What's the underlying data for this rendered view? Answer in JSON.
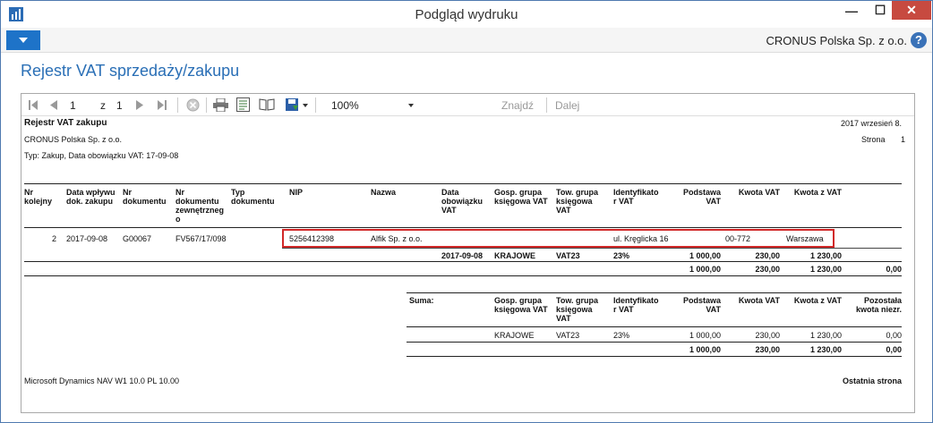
{
  "window": {
    "title": "Podgląd wydruku",
    "min": "—",
    "max": "☐",
    "close": "✕"
  },
  "ribbon": {
    "company": "CRONUS Polska Sp. z o.o.",
    "help": "?"
  },
  "page_title": "Rejestr VAT sprzedaży/zakupu",
  "toolbar": {
    "page_current": "1",
    "page_of": "z",
    "page_total": "1",
    "zoom": "100%",
    "find": "Znajdź",
    "next": "Dalej"
  },
  "report": {
    "title": "Rejestr VAT zakupu",
    "date": "2017 wrzesień 8.",
    "company": "CRONUS Polska Sp. z o.o.",
    "page_label": "Strona",
    "page_num": "1",
    "filter": "Typ: Zakup, Data obowiązku VAT: 17-09-08",
    "headers": {
      "nr": "Nr\nkolejny",
      "data_wplywu": "Data wpływu\ndok. zakupu",
      "nr_dok": "Nr\ndokumentu",
      "nr_zewn": "Nr\ndokumentu\nzewnętrzneg\no",
      "typ": "Typ\ndokumentu",
      "nip": "NIP",
      "nazwa": "Nazwa",
      "data_obow": "Data\nobowiązku\nVAT",
      "gosp": "Gosp. grupa\nksięgowa VAT",
      "tow": "Tow. grupa\nksięgowa\nVAT",
      "ident": "Identyfikato\nr VAT",
      "podstawa": "Podstawa\nVAT",
      "kwota_vat": "Kwota VAT",
      "kwota_z_vat": "Kwota z VAT"
    },
    "row": {
      "nr": "2",
      "data": "2017-09-08",
      "dok": "G00067",
      "zewn": "FV567/17/098",
      "nip": "5256412398",
      "nazwa": "Alfik Sp. z o.o.",
      "adres": "ul. Kręglicka 16",
      "kod": "00-772",
      "miasto": "Warszawa"
    },
    "detail": {
      "data": "2017-09-08",
      "gosp": "KRAJOWE",
      "tow": "VAT23",
      "ident": "23%",
      "podstawa": "1 000,00",
      "kwota_vat": "230,00",
      "kwota_z_vat": "1 230,00"
    },
    "total": {
      "podstawa": "1 000,00",
      "kwota_vat": "230,00",
      "kwota_z_vat": "1 230,00",
      "pozostala": "0,00"
    },
    "suma": {
      "label": "Suma:",
      "h_gosp": "Gosp. grupa\nksięgowa VAT",
      "h_tow": "Tow. grupa\nksięgowa\nVAT",
      "h_ident": "Identyfikato\nr VAT",
      "h_podstawa": "Podstawa\nVAT",
      "h_kwota_vat": "Kwota VAT",
      "h_kwota_z_vat": "Kwota z VAT",
      "h_pozostala": "Pozostała\nkwota niezr.",
      "gosp": "KRAJOWE",
      "tow": "VAT23",
      "ident": "23%",
      "podstawa": "1 000,00",
      "kwota_vat": "230,00",
      "kwota_z_vat": "1 230,00",
      "pozostala": "0,00",
      "t_podstawa": "1 000,00",
      "t_kwota_vat": "230,00",
      "t_kwota_z_vat": "1 230,00",
      "t_pozostala": "0,00"
    },
    "footer": {
      "version": "Microsoft Dynamics NAV W1 10.0  PL 10.00",
      "last": "Ostatnia strona"
    }
  }
}
